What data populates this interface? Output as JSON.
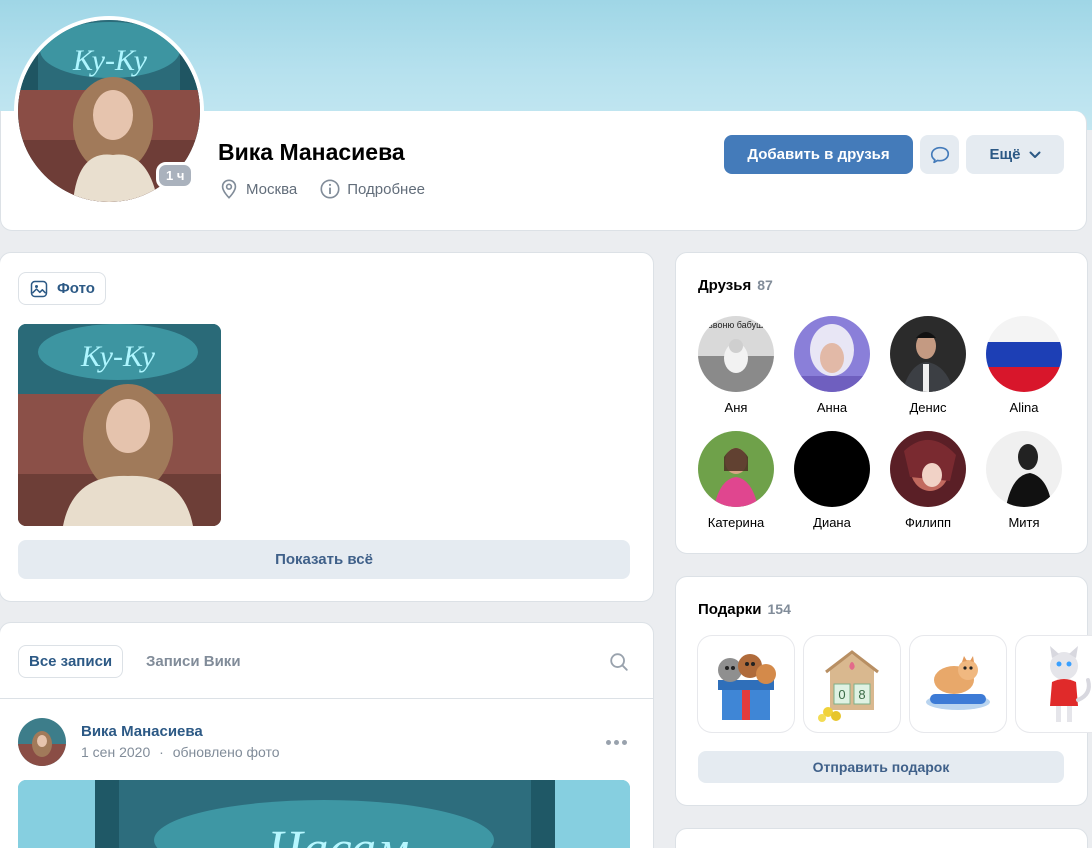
{
  "profile": {
    "name": "Вика Манасиева",
    "online_badge": "1 ч",
    "city": "Москва",
    "more_info": "Подробнее",
    "add_friend_label": "Добавить в друзья",
    "more_label": "Ещё"
  },
  "photos": {
    "tab_label": "Фото",
    "show_all_label": "Показать всё",
    "neon_text": "Ку-Ку"
  },
  "friends": {
    "title": "Друзья",
    "count": "87",
    "items": [
      {
        "name": "Аня",
        "photo_text": "звоню бабуш"
      },
      {
        "name": "Анна"
      },
      {
        "name": "Денис"
      },
      {
        "name": "Alina"
      },
      {
        "name": "Катерина"
      },
      {
        "name": "Диана"
      },
      {
        "name": "Филипп"
      },
      {
        "name": "Митя"
      }
    ]
  },
  "gifts": {
    "title": "Подарки",
    "count": "154",
    "send_label": "Отправить подарок",
    "calendar_digits": [
      "0",
      "8"
    ]
  },
  "wall": {
    "tabs": [
      {
        "label": "Все записи",
        "active": true
      },
      {
        "label": "Записи Вики",
        "active": false
      }
    ],
    "post": {
      "author": "Вика Манасиева",
      "date": "1 сен 2020",
      "separator": "·",
      "action": "обновлено фото",
      "image_text": "Часам"
    }
  },
  "colors": {
    "accent": "#447bba",
    "link": "#2c5985",
    "secondary_button": "#e5ebf1",
    "page_bg": "#ebedf0",
    "cover": "#a9dbe9"
  }
}
